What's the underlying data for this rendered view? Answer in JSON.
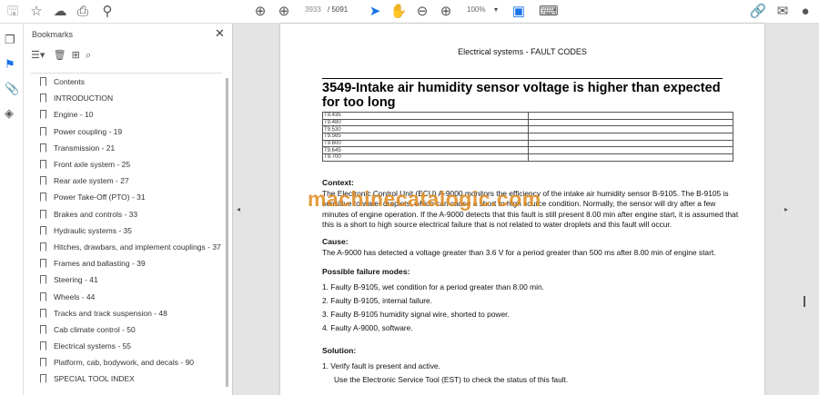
{
  "toolbar": {
    "page_current": "3933",
    "page_total": "/ 5091",
    "zoom": "100%"
  },
  "bookmarks": {
    "title": "Bookmarks",
    "items": [
      "Contents",
      "INTRODUCTION",
      "Engine - 10",
      "Power coupling - 19",
      "Transmission - 21",
      "Front axle system - 25",
      "Rear axle system - 27",
      "Power Take-Off (PTO) - 31",
      "Brakes and controls - 33",
      "Hydraulic systems - 35",
      "Hitches, drawbars, and implement couplings - 37",
      "Frames and ballasting - 39",
      "Steering - 41",
      "Wheels - 44",
      "Tracks and track suspension - 48",
      "Cab climate control - 50",
      "Electrical systems - 55",
      "Platform, cab, bodywork, and decals - 90",
      "SPECIAL TOOL INDEX"
    ]
  },
  "doc": {
    "header": "Electrical systems - FAULT CODES",
    "title": "3549-Intake air humidity sensor voltage is higher than expected for too long",
    "models": [
      "T9.435",
      "T9.480",
      "T9.530",
      "T9.565",
      "T9.600",
      "T9.645",
      "T9.700"
    ],
    "context_h": "Context:",
    "context": "The Electronic Control Unit (ECU) A-9000 monitors the efficiency of the intake air humidity sensor B-9105. The B-9105 is sensitive to water droplets, which can cause a short to high source condition. Normally, the sensor will dry after a few minutes of engine operation. If the A-9000 detects that this fault is still present 8.00 min after engine start, it is assumed that this is a short to high source electrical failure that is not related to water droplets and this fault will occur.",
    "cause_h": "Cause:",
    "cause": "The A-9000 has detected a voltage greater than 3.6 V for a period greater than 500 ms after 8.00 min of engine start.",
    "modes_h": "Possible failure modes:",
    "modes": [
      "1.  Faulty B-9105, wet condition for a period greater than 8.00 min.",
      "2.  Faulty B-9105, internal failure.",
      "3.  Faulty B-9105 humidity signal wire, shorted to power.",
      "4.  Faulty A-9000, software."
    ],
    "solution_h": "Solution:",
    "solution": [
      "1.  Verify fault is present and active.",
      "Use the Electronic Service Tool (EST) to check the status of this fault."
    ],
    "watermark": "machinecatalogic.com"
  }
}
